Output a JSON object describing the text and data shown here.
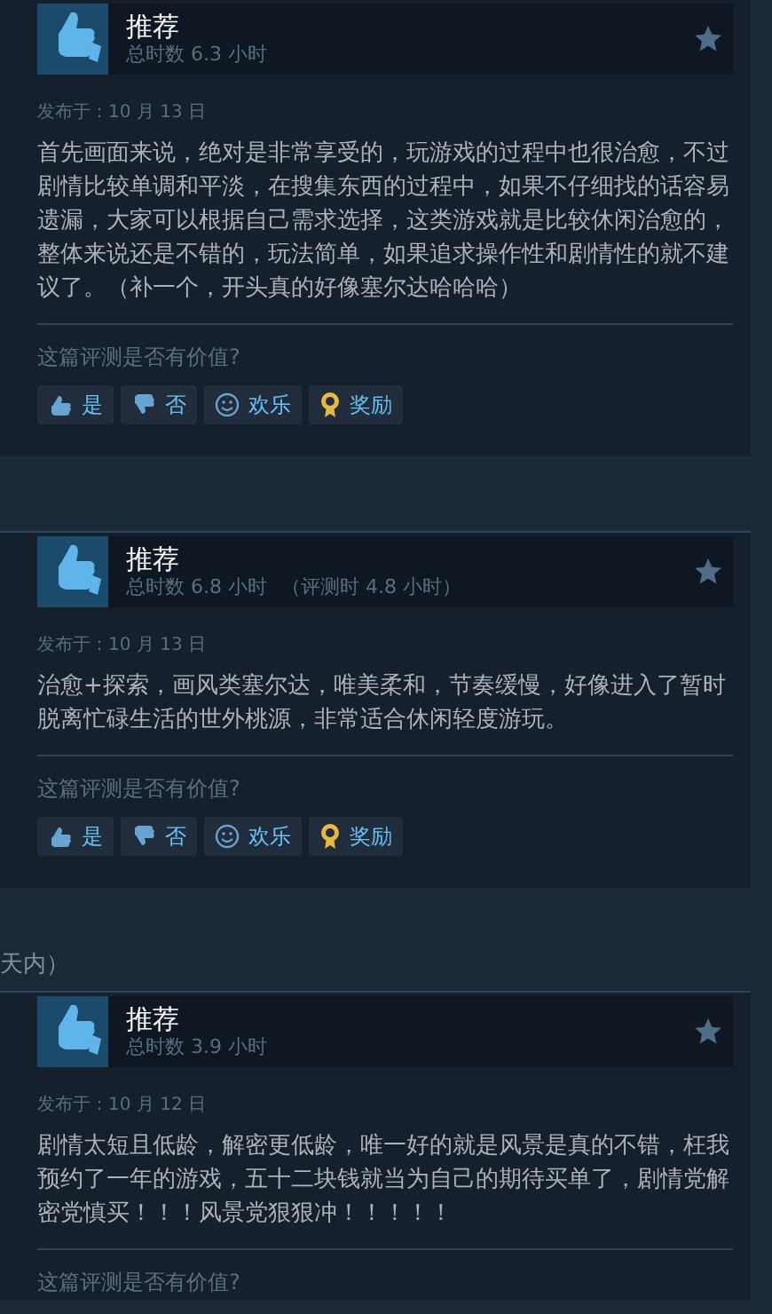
{
  "reviews": [
    {
      "verdict": "推荐",
      "playtime": "总时数 6.3 小时",
      "posted": "发布于：10 月 13 日",
      "body": "首先画面来说，绝对是非常享受的，玩游戏的过程中也很治愈，不过剧情比较单调和平淡，在搜集东西的过程中，如果不仔细找的话容易遗漏，大家可以根据自己需求选择，这类游戏就是比较休闲治愈的，整体来说还是不错的，玩法简单，如果追求操作性和剧情性的就不建议了。（补一个，开头真的好像塞尔达哈哈哈）",
      "question": "这篇评测是否有价值?",
      "buttons": [
        {
          "kind": "yes",
          "label": "是"
        },
        {
          "kind": "no",
          "label": "否"
        },
        {
          "kind": "funny",
          "label": "欢乐"
        },
        {
          "kind": "award",
          "label": "奖励"
        }
      ]
    },
    {
      "verdict": "推荐",
      "playtime": "总时数 6.8 小时",
      "review_time": "（评测时 4.8 小时）",
      "posted": "发布于：10 月 13 日",
      "body": "治愈+探索，画风类塞尔达，唯美柔和，节奏缓慢，好像进入了暂时脱离忙碌生活的世外桃源，非常适合休闲轻度游玩。",
      "question": "这篇评测是否有价值?",
      "buttons": [
        {
          "kind": "yes",
          "label": "是"
        },
        {
          "kind": "no",
          "label": "否"
        },
        {
          "kind": "funny",
          "label": "欢乐"
        },
        {
          "kind": "award",
          "label": "奖励"
        }
      ]
    },
    {
      "section_fragment": "天内）",
      "verdict": "推荐",
      "playtime": "总时数 3.9 小时",
      "posted": "发布于：10 月 12 日",
      "body": "剧情太短且低龄，解密更低龄，唯一好的就是风景是真的不错，枉我预约了一年的游戏，五十二块钱就当为自己的期待买单了，剧情党解密党慎买！！！风景党狠狠冲！！！！！",
      "question": "这篇评测是否有价值?"
    }
  ]
}
